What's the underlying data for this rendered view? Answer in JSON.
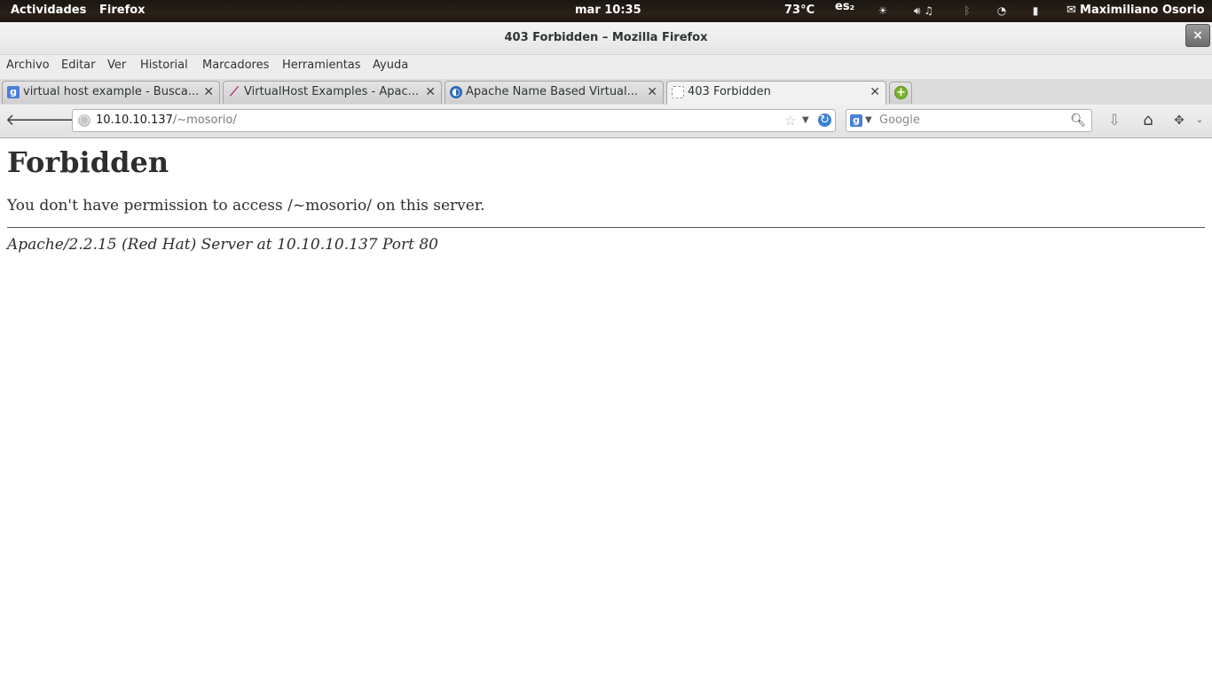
{
  "topbar": {
    "activities": "Actividades",
    "app": "Firefox",
    "clock": "mar 10:35",
    "temperature": "73°C",
    "keyboard": "es₂",
    "user": "Maximiliano Osorio"
  },
  "window": {
    "title": "403 Forbidden – Mozilla Firefox",
    "close": "×"
  },
  "menu": [
    "Archivo",
    "Editar",
    "Ver",
    "Historial",
    "Marcadores",
    "Herramientas",
    "Ayuda"
  ],
  "tabs": [
    {
      "label": "virtual host example - Busca...",
      "favicon": "google-icon",
      "color": "#4a7fdc"
    },
    {
      "label": "VirtualHost Examples - Apac...",
      "favicon": "apache-feather-icon",
      "color": "#b0287a"
    },
    {
      "label": "Apache Name Based Virtual...",
      "favicon": "site-icon",
      "color": "#2a6ab8"
    },
    {
      "label": "403 Forbidden",
      "favicon": "blank-page-icon",
      "color": "#ffffff",
      "selected": true
    }
  ],
  "url": {
    "host": "10.10.10.137",
    "path": "/~mosorio/"
  },
  "search": {
    "placeholder": "Google"
  },
  "page": {
    "heading": "Forbidden",
    "message": "You don't have permission to access /~mosorio/ on this server.",
    "address": "Apache/2.2.15 (Red Hat) Server at 10.10.10.137 Port 80"
  }
}
